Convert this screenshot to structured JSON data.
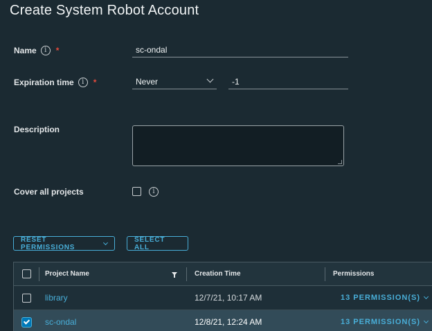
{
  "dialog": {
    "title": "Create System Robot Account"
  },
  "form": {
    "name": {
      "label": "Name",
      "value": "sc-ondal"
    },
    "expiration": {
      "label": "Expiration time",
      "select_value": "Never",
      "days_value": "-1"
    },
    "description": {
      "label": "Description",
      "value": ""
    },
    "cover_all": {
      "label": "Cover all projects"
    }
  },
  "actions": {
    "reset_permissions": "RESET PERMISSIONS",
    "select_all": "SELECT ALL"
  },
  "table": {
    "columns": [
      "Project Name",
      "Creation Time",
      "Permissions"
    ],
    "rows": [
      {
        "project": "library",
        "created": "12/7/21, 10:17 AM",
        "permissions": "13 PERMISSION(S)",
        "checked": false
      },
      {
        "project": "sc-ondal",
        "created": "12/8/21, 12:24 AM",
        "permissions": "13 PERMISSION(S)",
        "checked": true
      }
    ]
  },
  "colors": {
    "accent": "#49afd9",
    "background": "#1b2a32",
    "required": "#e74a3c",
    "selected_row": "#324b58"
  },
  "icons": [
    "info-icon",
    "chevron-down-icon",
    "filter-icon",
    "checkbox-icon",
    "checkmark-icon"
  ]
}
